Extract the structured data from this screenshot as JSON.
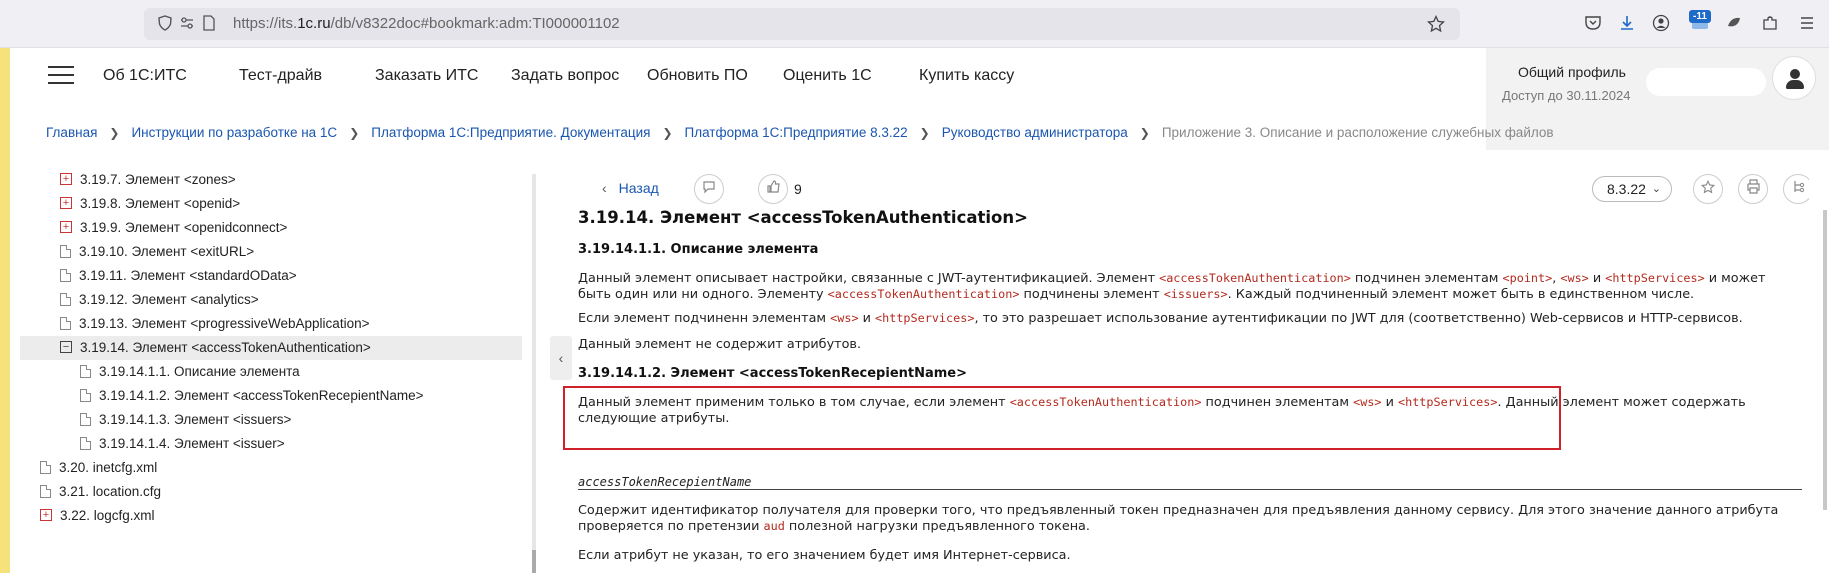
{
  "browser": {
    "url_prefix": "https://its.",
    "url_domain": "1c.ru",
    "url_path": "/db/v8322doc#bookmark:adm:TI000001102",
    "badge_count": "-11"
  },
  "nav": {
    "items": [
      "Об 1С:ИТС",
      "Тест-драйв",
      "Заказать ИТС",
      "Задать вопрос",
      "Обновить ПО",
      "Оценить 1С",
      "Купить кассу"
    ]
  },
  "profile": {
    "title": "Общий профиль",
    "access": "Доступ до 30.11.2024"
  },
  "breadcrumbs": {
    "items": [
      "Главная",
      "Инструкции по разработке на 1С",
      "Платформа 1С:Предприятие. Документация",
      "Платформа 1С:Предприятие 8.3.22",
      "Руководство администратора"
    ],
    "current": "Приложение 3. Описание и расположение служебных файлов"
  },
  "sidebar": {
    "items": [
      {
        "icon": "plus",
        "label": "3.19.7. Элемент <zones>"
      },
      {
        "icon": "plus",
        "label": "3.19.8. Элемент <openid>"
      },
      {
        "icon": "plus",
        "label": "3.19.9. Элемент <openidconnect>"
      },
      {
        "icon": "doc",
        "label": "3.19.10. Элемент <exitURL>"
      },
      {
        "icon": "doc",
        "label": "3.19.11. Элемент <standardOData>"
      },
      {
        "icon": "doc",
        "label": "3.19.12. Элемент <analytics>"
      },
      {
        "icon": "doc",
        "label": "3.19.13. Элемент <progressiveWebApplication>"
      },
      {
        "icon": "minus",
        "label": "3.19.14. Элемент <accessTokenAuthentication>"
      },
      {
        "icon": "doc",
        "label": "3.19.14.1.1. Описание элемента"
      },
      {
        "icon": "doc",
        "label": "3.19.14.1.2. Элемент <accessTokenRecepientName>"
      },
      {
        "icon": "doc",
        "label": "3.19.14.1.3. Элемент <issuers>"
      },
      {
        "icon": "doc",
        "label": "3.19.14.1.4. Элемент <issuer>"
      },
      {
        "icon": "doc",
        "label": "3.20. inetcfg.xml"
      },
      {
        "icon": "doc",
        "label": "3.21. location.cfg"
      },
      {
        "icon": "plus",
        "label": "3.22. logcfg.xml"
      }
    ]
  },
  "content": {
    "back_label": "Назад",
    "likes": "9",
    "version": "8.3.22",
    "h1": "3.19.14. Элемент <accessTokenAuthentication>",
    "h2_desc": "3.19.14.1.1. Описание элемента",
    "p1": {
      "t1": "Данный элемент описывает настройки, связанные с JWT-аутентификацией. Элемент ",
      "c1": "<accessTokenAuthentication>",
      "t2": " подчинен элементам ",
      "c2": "<point>",
      "t3": ", ",
      "c3": "<ws>",
      "t4": " и ",
      "c4": "<httpServices>",
      "t5": " и может быть один или ни одного. Элементу ",
      "c5": "<accessTokenAuthentication>",
      "t6": " подчинены элемент ",
      "c6": "<issuers>",
      "t7": ". Каждый подчиненный элемент может быть в единственном числе."
    },
    "p2": {
      "t1": "Если элемент подчиненн элементам ",
      "c1": "<ws>",
      "t2": " и ",
      "c2": "<httpServices>",
      "t3": ", то это разрешает использование аутентификации по JWT для (соответственно) Web-сервисов и HTTP-сервисов."
    },
    "p3": "Данный элемент не содержит атрибутов.",
    "h2_name": "3.19.14.1.2. Элемент <accessTokenRecepientName>",
    "p4": {
      "t1": "Данный элемент применим только в том случае, если элемент ",
      "c1": "<accessTokenAuthentication>",
      "t2": " подчинен элементам ",
      "c2": "<ws>",
      "t3": " и ",
      "c3": "<httpServices>",
      "t4": ". Данный элемент может содержать следующие атрибуты."
    },
    "attr_name": "accessTokenRecepientName",
    "p5": {
      "t1": "Содержит идентификатор получателя для проверки того, что предъявленный токен предназначен для предъявления данному сервису. Для этого значение данного атрибута проверяется по претензии ",
      "c1": "aud",
      "t2": " полезной нагрузки предъявленного токена."
    },
    "p6": "Если атрибут не указан, то его значением будет имя Интернет-сервиса."
  }
}
